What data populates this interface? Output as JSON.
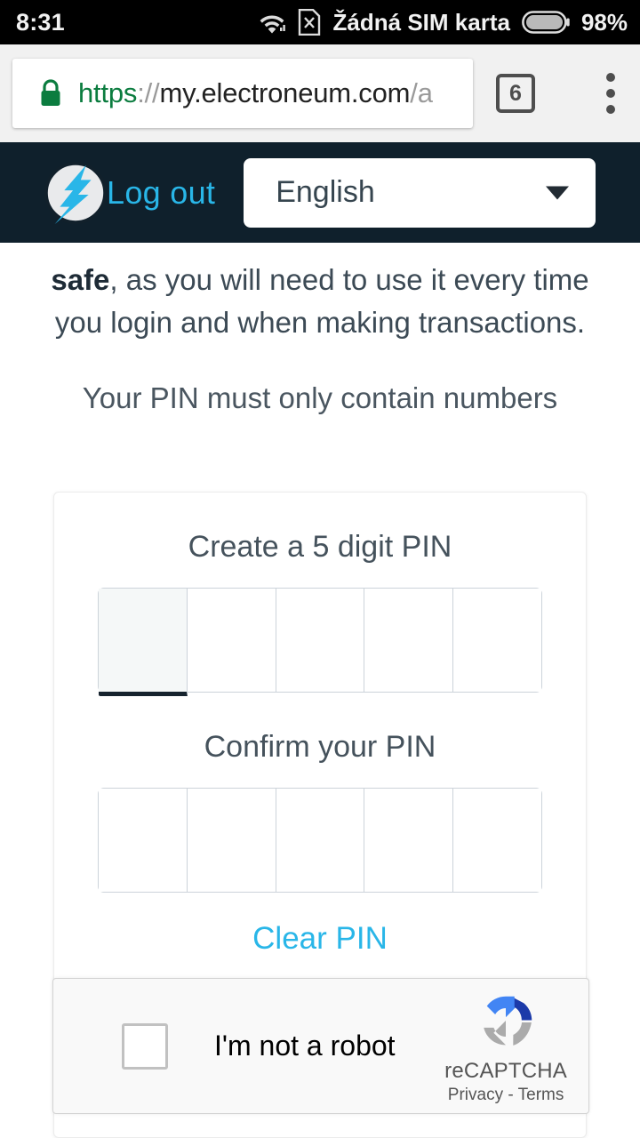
{
  "status_bar": {
    "time": "8:31",
    "sim_text": "Žádná SIM karta",
    "battery_percent": "98%",
    "icons": [
      "wifi-icon",
      "no-sim-icon",
      "battery-icon"
    ]
  },
  "browser": {
    "url_scheme": "https",
    "url_separator": "://",
    "url_host": "my.electroneum.com",
    "url_path": "/a",
    "tab_count": "6",
    "lock_icon": "lock-icon",
    "menu_icon": "kebab-menu-icon"
  },
  "site_header": {
    "logo": "electroneum-logo-icon",
    "logout_label": "Log out",
    "language_selected": "English",
    "language_options": [
      "English"
    ],
    "caret_icon": "chevron-down-icon",
    "background_color": "#0f202c",
    "accent_color": "#29b6e8"
  },
  "content": {
    "intro_bold": "safe",
    "intro_rest": ", as you will need to use it every time you login and when making transactions.",
    "note": "Your PIN must only contain numbers"
  },
  "pin_card": {
    "create_label": "Create a 5 digit PIN",
    "confirm_label": "Confirm your PIN",
    "clear_label": "Clear PIN",
    "digit_count": 5,
    "create_values": [
      "",
      "",
      "",
      "",
      ""
    ],
    "confirm_values": [
      "",
      "",
      "",
      "",
      ""
    ],
    "focused_index": 0,
    "border_color": "#ccd3da",
    "focus_underline_color": "#16232e"
  },
  "recaptcha": {
    "checkbox_label": "I'm not a robot",
    "checked": false,
    "brand_name": "reCAPTCHA",
    "links": "Privacy - Terms",
    "logo_icon": "recaptcha-logo-icon"
  }
}
